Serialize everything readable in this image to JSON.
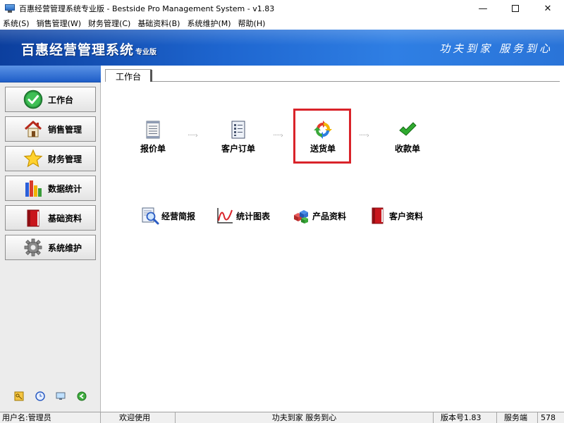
{
  "window": {
    "title": "百惠经营管理系统专业版 - Bestside Pro Management System - v1.83",
    "minimize_glyph": "—",
    "close_glyph": "✕"
  },
  "menu": [
    "系统(S)",
    "销售管理(W)",
    "财务管理(C)",
    "基础资料(B)",
    "系统维护(M)",
    "帮助(H)"
  ],
  "banner": {
    "title": "百惠经营管理系统",
    "edition": "专业版",
    "slogan": "功夫到家 服务到心"
  },
  "sidebar": {
    "items": [
      {
        "label": "工作台",
        "icon": "green-check-circle-icon"
      },
      {
        "label": "销售管理",
        "icon": "house-icon"
      },
      {
        "label": "财务管理",
        "icon": "star-icon"
      },
      {
        "label": "数据统计",
        "icon": "bar-chart-icon"
      },
      {
        "label": "基础资料",
        "icon": "red-book-icon"
      },
      {
        "label": "系统维护",
        "icon": "gear-icon"
      }
    ],
    "tools": [
      "key-icon",
      "clock-icon",
      "monitor-icon",
      "green-arrow-icon"
    ]
  },
  "tabs": [
    {
      "label": "工作台",
      "active": true
    }
  ],
  "flow": {
    "items": [
      {
        "label": "报价单",
        "icon": "document-list-icon"
      },
      {
        "label": "客户订单",
        "icon": "order-form-icon"
      },
      {
        "label": "送货单",
        "icon": "recycle-arrows-icon",
        "highlighted": true
      },
      {
        "label": "收款单",
        "icon": "green-checkmark-icon"
      }
    ],
    "connector": "·····›"
  },
  "quick_links": [
    {
      "label": "经营简报",
      "icon": "magnifier-report-icon"
    },
    {
      "label": "统计图表",
      "icon": "line-chart-icon"
    },
    {
      "label": "产品资料",
      "icon": "cubes-icon"
    },
    {
      "label": "客户资料",
      "icon": "red-binder-icon"
    }
  ],
  "status": {
    "user": "用户名:管理员",
    "welcome": "欢迎使用",
    "slogan": "功夫到家 服务到心",
    "version": "版本号1.83",
    "server": "服务端",
    "extra": "578"
  },
  "colors": {
    "banner": "#1e66d0",
    "highlight": "#d9232a",
    "sidebar_bg": "#ececec"
  }
}
